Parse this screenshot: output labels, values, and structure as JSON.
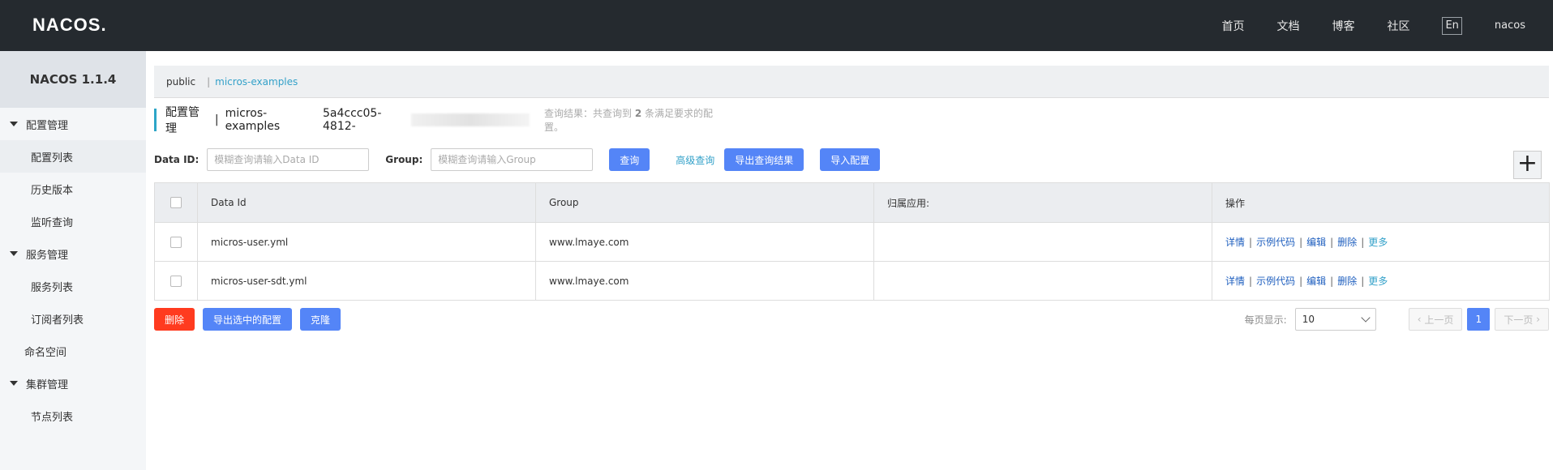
{
  "topbar": {
    "logo": "NACOS.",
    "nav": [
      "首页",
      "文档",
      "博客",
      "社区"
    ],
    "lang": "En",
    "user": "nacos"
  },
  "sidebar": {
    "version": "NACOS 1.1.4",
    "groups": [
      {
        "label": "配置管理",
        "items": [
          "配置列表",
          "历史版本",
          "监听查询"
        ]
      },
      {
        "label": "服务管理",
        "items": [
          "服务列表",
          "订阅者列表"
        ]
      },
      {
        "label": "命名空间"
      },
      {
        "label": "集群管理",
        "items": [
          "节点列表"
        ]
      }
    ]
  },
  "namespaces": {
    "public": "public",
    "current": "micros-examples"
  },
  "title": {
    "section": "配置管理",
    "namespace": "micros-examples",
    "namespace_id": "5a4ccc05-4812-",
    "result_prefix": "查询结果：共查询到",
    "result_count": "2",
    "result_suffix": "条满足要求的配置。"
  },
  "filters": {
    "dataid_label": "Data ID:",
    "dataid_placeholder": "模糊查询请输入Data ID",
    "group_label": "Group:",
    "group_placeholder": "模糊查询请输入Group",
    "query": "查询",
    "advanced": "高级查询",
    "export_results": "导出查询结果",
    "import": "导入配置"
  },
  "table": {
    "columns": [
      "Data Id",
      "Group",
      "归属应用:",
      "操作"
    ],
    "rows": [
      {
        "data_id": "micros-user.yml",
        "group": "www.lmaye.com",
        "app": ""
      },
      {
        "data_id": "micros-user-sdt.yml",
        "group": "www.lmaye.com",
        "app": ""
      }
    ],
    "ops": {
      "detail": "详情",
      "sample": "示例代码",
      "edit": "编辑",
      "delete": "删除",
      "more": "更多"
    }
  },
  "bottom": {
    "delete": "删除",
    "export_selected": "导出选中的配置",
    "clone": "克隆"
  },
  "pager": {
    "per_page_label": "每页显示:",
    "per_page": "10",
    "prev": "上一页",
    "current": "1",
    "next": "下一页"
  },
  "plus_symbol": "+",
  "colors": {
    "primary": "#5485f7",
    "danger": "#ff3b1f",
    "link": "#33a1c9",
    "topbar": "#252a2f"
  }
}
